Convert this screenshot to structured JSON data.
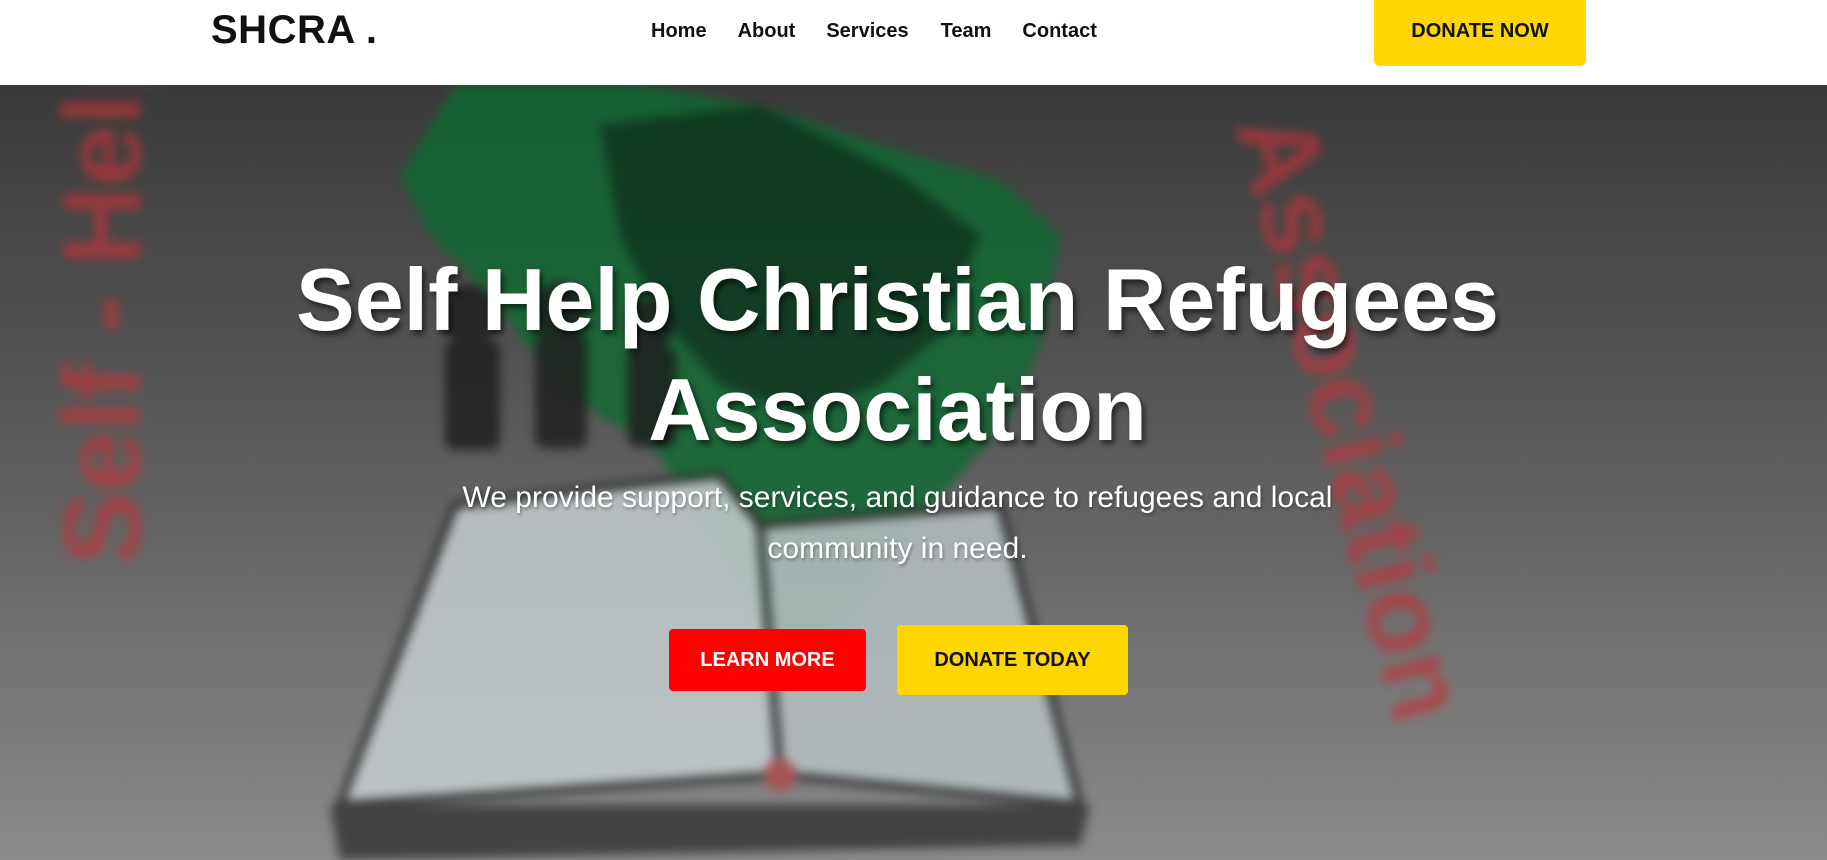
{
  "header": {
    "logo": "SHCRA .",
    "nav": [
      {
        "label": "Home"
      },
      {
        "label": "About"
      },
      {
        "label": "Services"
      },
      {
        "label": "Team"
      },
      {
        "label": "Contact"
      }
    ],
    "donate_button": "DONATE NOW"
  },
  "hero": {
    "title_line1": "Self Help Christian Refugees",
    "title_line2": "Association",
    "subtitle_line1": "We provide support, services, and guidance to refugees and local",
    "subtitle_line2": "community in need.",
    "learn_more": "LEARN MORE",
    "donate_today": "DONATE TODAY",
    "background_logo_text_left": "Self - Help C",
    "background_logo_text_right": "Association"
  },
  "colors": {
    "accent_yellow": "#ffd600",
    "accent_red": "#ff0000",
    "nav_text": "#111111"
  }
}
